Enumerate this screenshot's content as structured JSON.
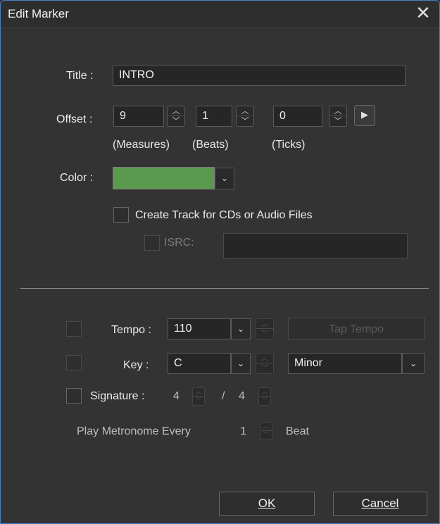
{
  "window": {
    "title": "Edit Marker"
  },
  "title_row": {
    "label": "Title :",
    "value": "INTRO"
  },
  "offset_row": {
    "label": "Offset :",
    "measures": "9",
    "beats": "1",
    "ticks": "0",
    "measures_caption": "(Measures)",
    "beats_caption": "(Beats)",
    "ticks_caption": "(Ticks)"
  },
  "color_row": {
    "label": "Color :",
    "swatch_color": "#5a9a4e"
  },
  "cd_track": {
    "label": "Create Track for CDs or Audio Files",
    "checked": false
  },
  "isrc": {
    "label": "ISRC:",
    "value": ""
  },
  "tempo": {
    "label": "Tempo :",
    "value": "110",
    "tap_label": "Tap Tempo"
  },
  "key": {
    "label": "Key :",
    "value": "C",
    "mode": "Minor"
  },
  "signature": {
    "label": "Signature :",
    "numerator": "4",
    "separator": "/",
    "denominator": "4"
  },
  "metronome": {
    "label": "Play Metronome Every",
    "value": "1",
    "unit": "Beat"
  },
  "buttons": {
    "ok": "OK",
    "cancel": "Cancel"
  },
  "icons": {
    "close": "close-icon",
    "play": "play-icon",
    "chevron": "chevron-down-icon",
    "spin": "spinner-arrows-icon"
  }
}
